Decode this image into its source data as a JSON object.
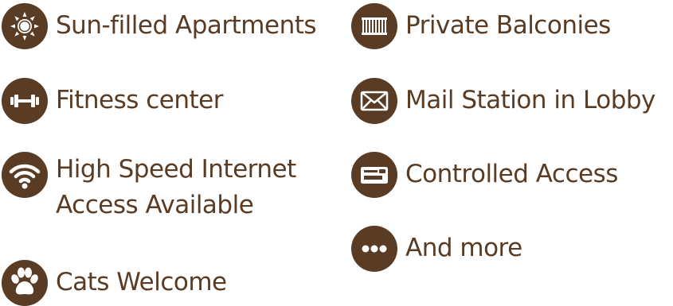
{
  "colors": {
    "brand": "#5a3b23",
    "background": "#ffffff"
  },
  "features": {
    "sun": {
      "label": "Sun-filled Apartments",
      "icon": "sun-icon"
    },
    "fitness": {
      "label": "Fitness center",
      "icon": "dumbbell-icon"
    },
    "internet": {
      "line1": "High Speed Internet",
      "line2": "Access Available",
      "icon": "wifi-icon"
    },
    "cats": {
      "label": "Cats Welcome",
      "icon": "paw-icon"
    },
    "balconies": {
      "label": "Private Balconies",
      "icon": "balcony-icon"
    },
    "mail": {
      "label": "Mail Station in Lobby",
      "icon": "envelope-icon"
    },
    "access": {
      "label": "Controlled Access",
      "icon": "keycard-icon"
    },
    "more": {
      "label": "And more",
      "icon": "ellipsis-icon"
    }
  }
}
